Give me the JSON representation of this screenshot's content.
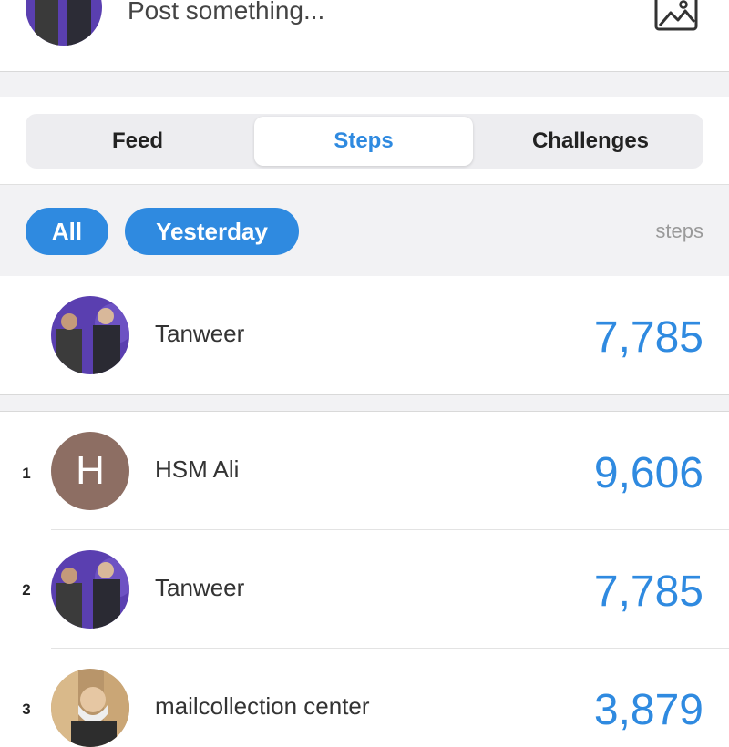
{
  "composer": {
    "placeholder": "Post something..."
  },
  "tabs": [
    {
      "label": "Feed",
      "active": false
    },
    {
      "label": "Steps",
      "active": true
    },
    {
      "label": "Challenges",
      "active": false
    }
  ],
  "filters": {
    "all": "All",
    "yesterday": "Yesterday",
    "unit": "steps"
  },
  "me": {
    "name": "Tanweer",
    "value": "7,785"
  },
  "leaderboard": [
    {
      "rank": "1",
      "initial": "H",
      "name": "HSM Ali",
      "value": "9,606"
    },
    {
      "rank": "2",
      "name": "Tanweer",
      "value": "7,785"
    },
    {
      "rank": "3",
      "name": "mailcollection center",
      "value": "3,879"
    }
  ],
  "colors": {
    "accent": "#2f8ae0",
    "avatar_letter_bg": "#8d6e63"
  }
}
